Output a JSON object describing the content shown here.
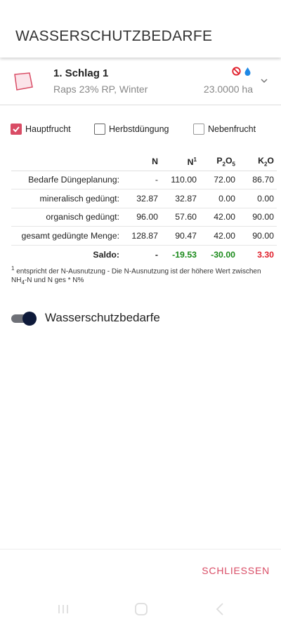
{
  "header": {
    "title": "WASSERSCHUTZBEDARFE"
  },
  "field": {
    "name": "1. Schlag 1",
    "crop": "Raps 23% RP, Winter",
    "area": "23.0000 ha",
    "shape_color": "#d94c65",
    "icons": [
      "no-entry-icon",
      "water-drop-icon",
      "chevron-down-icon"
    ]
  },
  "checkboxes": [
    {
      "label": "Hauptfrucht",
      "checked": true
    },
    {
      "label": "Herbstdüngung",
      "checked": false
    },
    {
      "label": "Nebenfrucht",
      "checked": false
    }
  ],
  "table": {
    "headers": {
      "n": "N",
      "n1": "N",
      "n1_sup": "1",
      "p_a": "P",
      "p_sub1": "2",
      "p_b": "O",
      "p_sub2": "5",
      "k_a": "K",
      "k_sub": "2",
      "k_b": "O"
    },
    "rows": [
      {
        "label": "Bedarfe Düngeplanung:",
        "n": "-",
        "n1": "110.00",
        "p": "72.00",
        "k": "86.70"
      },
      {
        "label": "mineralisch gedüngt:",
        "n": "32.87",
        "n1": "32.87",
        "p": "0.00",
        "k": "0.00"
      },
      {
        "label": "organisch gedüngt:",
        "n": "96.00",
        "n1": "57.60",
        "p": "42.00",
        "k": "90.00"
      },
      {
        "label": "gesamt gedüngte Menge:",
        "n": "128.87",
        "n1": "90.47",
        "p": "42.00",
        "k": "90.00"
      },
      {
        "label": "Saldo:",
        "n": "-",
        "n1": "-19.53",
        "p": "-30.00",
        "k": "3.30"
      }
    ]
  },
  "footnote": {
    "marker": "1",
    "text_a": " entspricht der N-Ausnutzung - Die N-Ausnutzung ist der höhere Wert zwischen NH",
    "sub": "4",
    "text_b": "-N und N ges * N%"
  },
  "toggle": {
    "label": "Wasserschutzbedarfe",
    "on": true
  },
  "footer": {
    "close_label": "SCHLIESSEN"
  },
  "colors": {
    "accent": "#d94c65",
    "positive": "#1a8a1a",
    "negative": "#e01e2a"
  }
}
